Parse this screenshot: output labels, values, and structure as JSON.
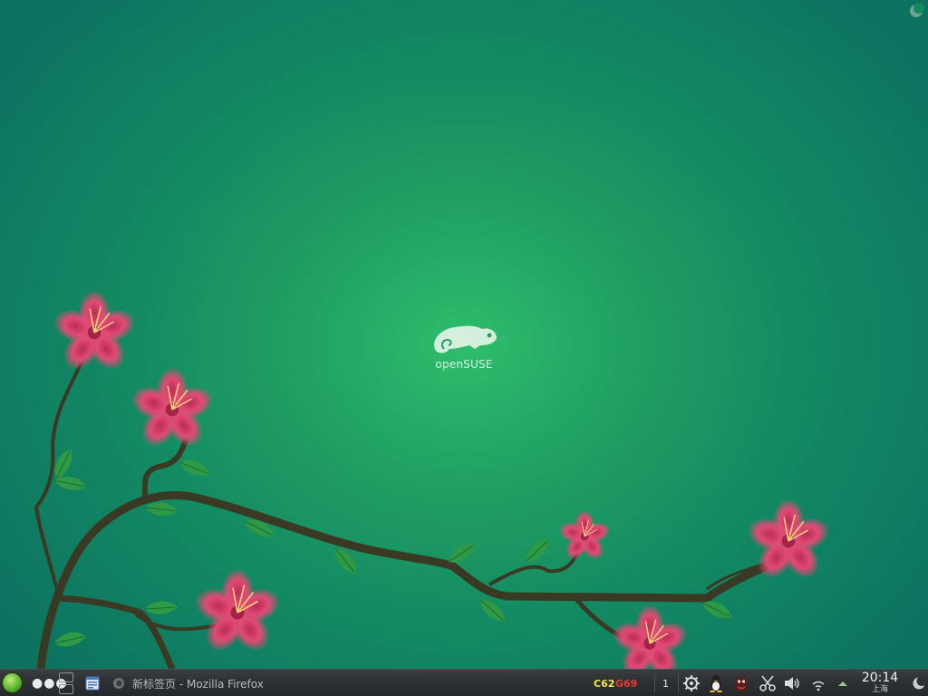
{
  "desktop": {
    "logo_text": "openSUSE",
    "colors": {
      "background_center": "#2fbd6c",
      "background_edge": "#0d7360",
      "flower": "#e0426e",
      "branch": "#3c3a26",
      "leaf": "#2e9a45"
    }
  },
  "panel": {
    "launcher_icon": "opensuse-launcher-icon",
    "taskbar": {
      "active_window_title": "新标签页 - Mozilla Firefox"
    },
    "monitors": {
      "cpu_label": "C62",
      "gpu_label": "G69",
      "cpu_color": "#f2e94a",
      "gpu_color": "#e8382f"
    },
    "tray": {
      "counter": "1",
      "icons": [
        "settings-gear-icon",
        "tux-penguin-icon",
        "qq-penguin-icon",
        "scissors-icon",
        "volume-icon",
        "network-icon",
        "expand-arrow-icon"
      ]
    },
    "clock": {
      "time": "20:14",
      "location": "上海"
    }
  }
}
